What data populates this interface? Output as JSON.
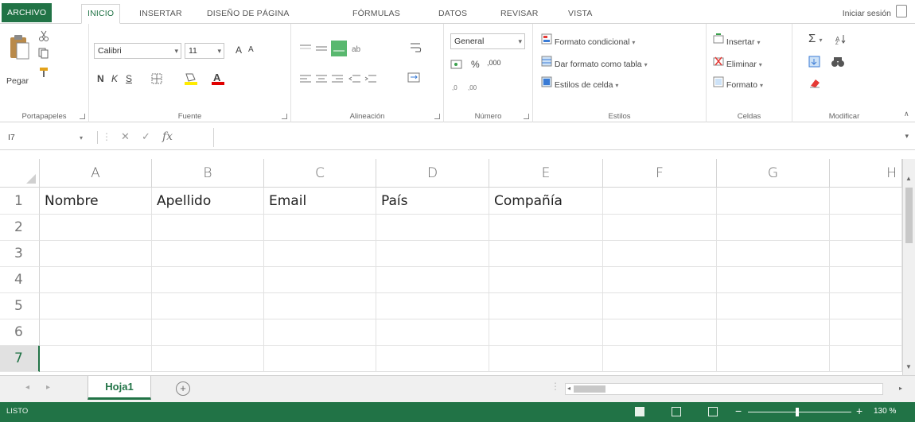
{
  "ribbon_tabs": {
    "file": "ARCHIVO",
    "home": "INICIO",
    "insert": "INSERTAR",
    "page_layout": "DISEÑO DE PÁGINA",
    "formulas": "FÓRMULAS",
    "data": "DATOS",
    "review": "REVISAR",
    "view": "VISTA"
  },
  "account": {
    "sign_in": "Iniciar sesión"
  },
  "clipboard": {
    "paste": "Pegar",
    "label": "Portapapeles"
  },
  "font": {
    "name": "Calibri",
    "size": "11",
    "bold": "N",
    "italic": "K",
    "underline": "S",
    "label": "Fuente",
    "increase": "A",
    "decrease": "A"
  },
  "alignment": {
    "label": "Alineación"
  },
  "number": {
    "format": "General",
    "percent": "%",
    "label": "Número"
  },
  "styles": {
    "conditional": "Formato condicional",
    "as_table": "Dar formato como tabla",
    "cell_styles": "Estilos de celda",
    "label": "Estilos"
  },
  "cells": {
    "insert": "Insertar",
    "delete": "Eliminar",
    "format": "Formato",
    "label": "Celdas"
  },
  "editing": {
    "label": "Modificar"
  },
  "formula_bar": {
    "name_box": "I7",
    "fx": "fx",
    "value": ""
  },
  "sheet": {
    "columns": [
      "A",
      "B",
      "C",
      "D",
      "E",
      "F",
      "G",
      "H"
    ],
    "rows": [
      "1",
      "2",
      "3",
      "4",
      "5",
      "6",
      "7"
    ],
    "row1": [
      "Nombre",
      "Apellido",
      "Email",
      "País",
      "Compañía",
      "",
      "",
      ""
    ],
    "selected_row": "7"
  },
  "sheet_tabs": {
    "active": "Hoja1",
    "add": "+"
  },
  "status": {
    "ready": "LISTO",
    "zoom": "130 %"
  },
  "colors": {
    "excel_green": "#217346"
  }
}
